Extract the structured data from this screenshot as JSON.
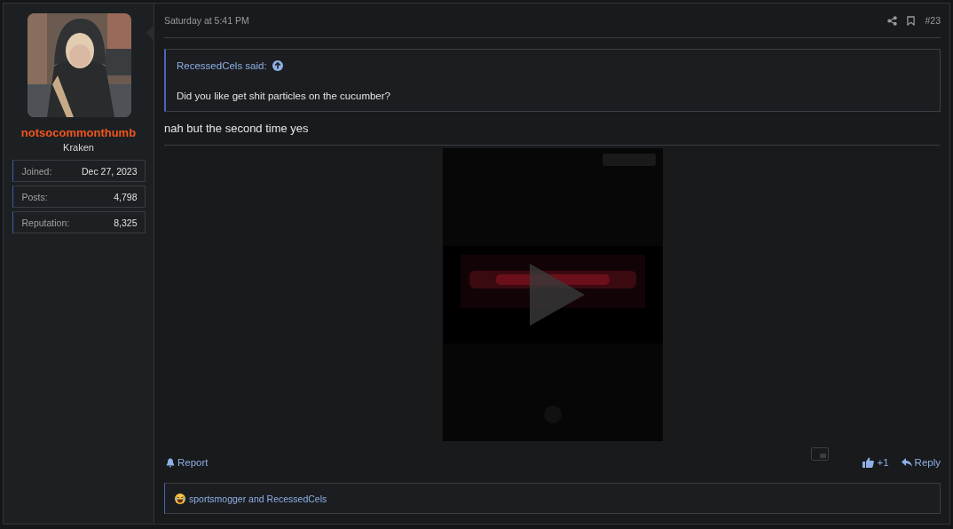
{
  "author": {
    "username": "notsocommonthumb",
    "title": "Kraken",
    "stats": [
      {
        "label": "Joined:",
        "value": "Dec 27, 2023"
      },
      {
        "label": "Posts:",
        "value": "4,798"
      },
      {
        "label": "Reputation:",
        "value": "8,325"
      }
    ]
  },
  "post": {
    "time": "Saturday at 5:41 PM",
    "number": "#23",
    "quote": {
      "author": "RecessedCels said:",
      "text": "Did you like get shit particles on the cucumber?"
    },
    "message": "nah but the second time yes",
    "actions_left": [
      {
        "label": "Report"
      }
    ],
    "reaction_count": "+1",
    "reply": "Reply",
    "reactions": {
      "users": "sportsmogger and RecessedCels"
    }
  }
}
